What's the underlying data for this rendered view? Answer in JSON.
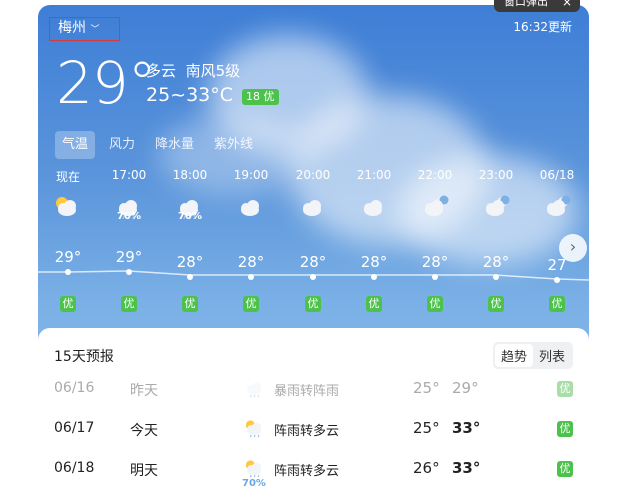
{
  "popup": {
    "label": "窗口弹出",
    "close": "×"
  },
  "header": {
    "city": "梅州",
    "updated": "16:32更新"
  },
  "current": {
    "temp": "29°",
    "condition": "多云",
    "wind": "南风5级",
    "range": "25~33°C",
    "aqi": "18 优"
  },
  "tabs": [
    "气温",
    "风力",
    "降水量",
    "紫外线"
  ],
  "hourly": [
    {
      "time": "现在",
      "icon": "sun-cloud-icon",
      "pop": "",
      "temp": "29°",
      "aq": "优"
    },
    {
      "time": "17:00",
      "icon": "rain-cloud-icon",
      "pop": "70%",
      "temp": "29°",
      "aq": "优"
    },
    {
      "time": "18:00",
      "icon": "rain-cloud-icon",
      "pop": "70%",
      "temp": "28°",
      "aq": "优"
    },
    {
      "time": "19:00",
      "icon": "cloud-icon",
      "pop": "",
      "temp": "28°",
      "aq": "优"
    },
    {
      "time": "20:00",
      "icon": "cloud-icon",
      "pop": "",
      "temp": "28°",
      "aq": "优"
    },
    {
      "time": "21:00",
      "icon": "cloud-icon",
      "pop": "",
      "temp": "28°",
      "aq": "优"
    },
    {
      "time": "22:00",
      "icon": "moon-cloud-icon",
      "pop": "",
      "temp": "28°",
      "aq": "优"
    },
    {
      "time": "23:00",
      "icon": "moon-cloud-icon",
      "pop": "",
      "temp": "28°",
      "aq": "优"
    },
    {
      "time": "06/18",
      "icon": "moon-cloud-icon",
      "pop": "",
      "temp": "27",
      "aq": "优"
    }
  ],
  "forecast": {
    "title": "15天预报",
    "views": [
      "趋势",
      "列表"
    ],
    "days": [
      {
        "date": "06/16",
        "day": "昨天",
        "icon": "rain-cloud-icon",
        "desc": "暴雨转阵雨",
        "low": "25°",
        "high": "29°",
        "aq": "优",
        "pop": ""
      },
      {
        "date": "06/17",
        "day": "今天",
        "icon": "sun-rain-icon",
        "desc": "阵雨转多云",
        "low": "25°",
        "high": "33°",
        "aq": "优",
        "pop": ""
      },
      {
        "date": "06/18",
        "day": "明天",
        "icon": "sun-rain-icon",
        "desc": "阵雨转多云",
        "low": "26°",
        "high": "33°",
        "aq": "优",
        "pop": "70%"
      }
    ]
  },
  "colors": {
    "sky": "#4a88d8",
    "aqi_green": "#4cc24c",
    "highlight_box": "#d43b3b"
  }
}
